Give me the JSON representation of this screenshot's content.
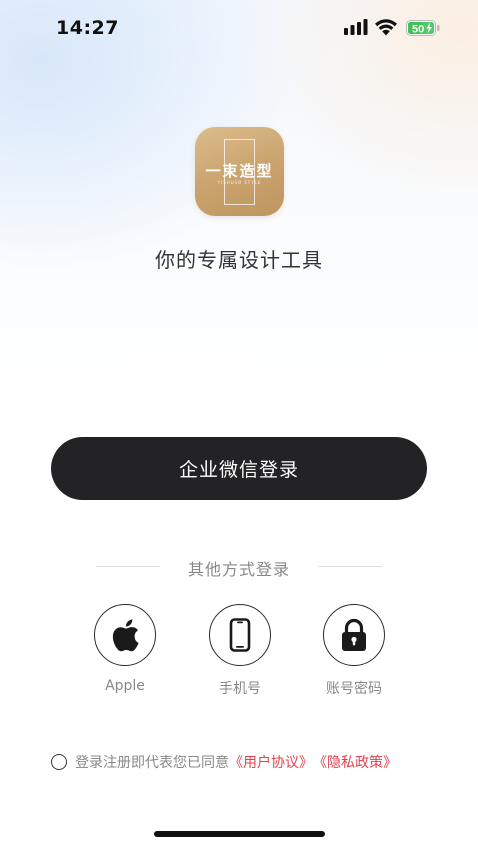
{
  "status_bar": {
    "time": "14:27",
    "battery": "50",
    "icons": [
      "signal-icon",
      "wifi-icon",
      "battery-icon"
    ]
  },
  "app": {
    "logo_text": "一束造型",
    "logo_subtext": "YISHUSB STYLE",
    "tagline": "你的专属设计工具"
  },
  "login": {
    "wecom_button": "企业微信登录",
    "other_methods": "其他方式登录",
    "options": [
      {
        "label": "Apple",
        "icon": "apple-icon"
      },
      {
        "label": "手机号",
        "icon": "phone-icon"
      },
      {
        "label": "账号密码",
        "icon": "lock-icon"
      }
    ]
  },
  "agreement": {
    "prefix": "登录注册即代表您已同意",
    "user_agreement": "《用户协议》",
    "privacy_policy": "《隐私政策》"
  },
  "colors": {
    "button_bg": "#232325",
    "link": "#e0434f",
    "logo_gold": "#c9a26c"
  }
}
